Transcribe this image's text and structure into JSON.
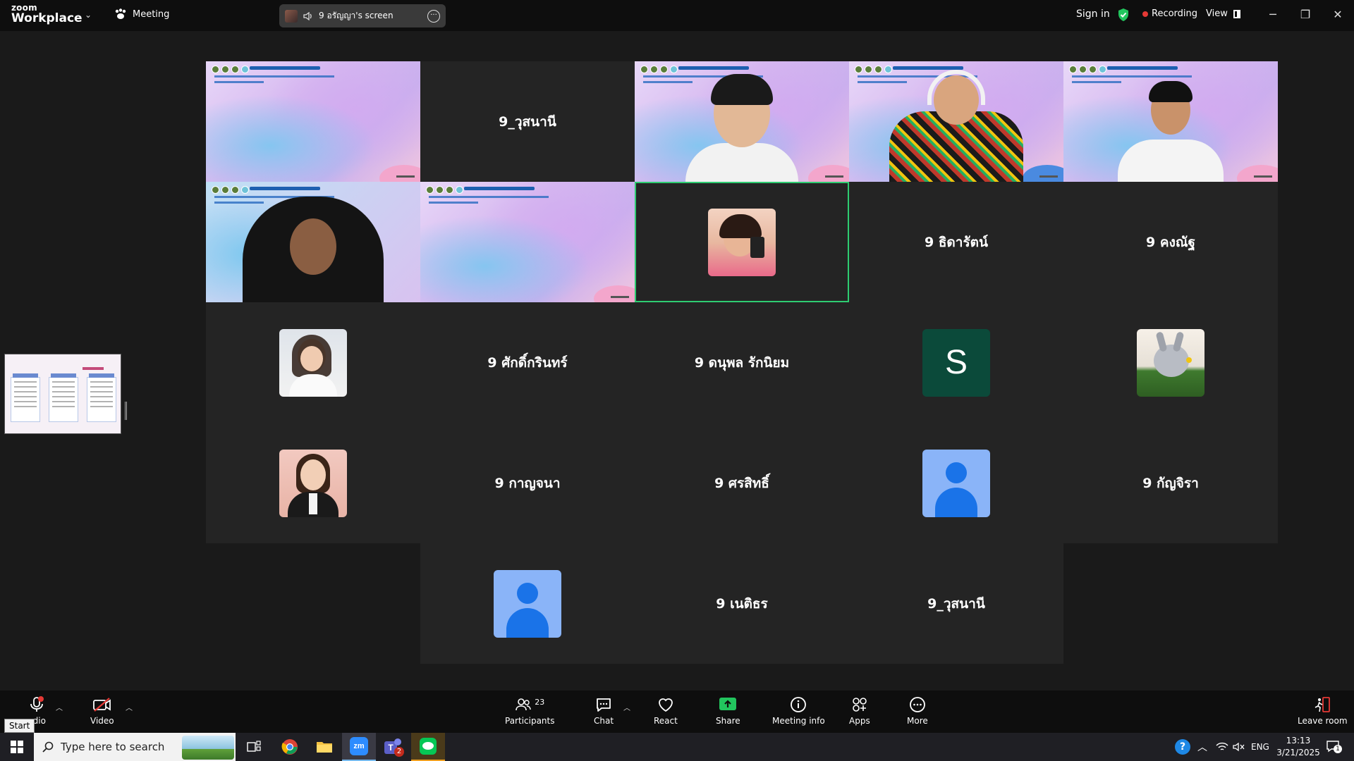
{
  "titlebar": {
    "logo_top": "zoom",
    "logo_bottom": "Workplace",
    "meeting_label": "Meeting",
    "share_label": "9 อรัญญา's screen",
    "sign_in": "Sign in",
    "recording": "Recording",
    "view": "View"
  },
  "tiles": [
    {
      "name": "",
      "kind": "slide"
    },
    {
      "name": "9_วุสนานี",
      "kind": "name"
    },
    {
      "name": "",
      "kind": "video"
    },
    {
      "name": "",
      "kind": "video"
    },
    {
      "name": "",
      "kind": "video"
    },
    {
      "name": "",
      "kind": "video"
    },
    {
      "name": "",
      "kind": "slide"
    },
    {
      "name": "",
      "kind": "photo"
    },
    {
      "name": "9 ธิดารัตน์",
      "kind": "name"
    },
    {
      "name": "9 คงณัฐ",
      "kind": "name"
    },
    {
      "name": "",
      "kind": "photo"
    },
    {
      "name": "9 ศักดิ์กรินทร์",
      "kind": "name"
    },
    {
      "name": "9 ดนุพล รักนิยม",
      "kind": "name"
    },
    {
      "name": "S",
      "kind": "letter"
    },
    {
      "name": "",
      "kind": "photo"
    },
    {
      "name": "",
      "kind": "photo"
    },
    {
      "name": "9 กาญจนา",
      "kind": "name"
    },
    {
      "name": "9 ศรสิทธิ์",
      "kind": "name"
    },
    {
      "name": "",
      "kind": "avatar"
    },
    {
      "name": "9 กัญจิรา",
      "kind": "name"
    },
    {
      "name": "",
      "kind": "avatar"
    },
    {
      "name": "9 เนติธร",
      "kind": "name"
    },
    {
      "name": "9_วุสนานี",
      "kind": "name"
    }
  ],
  "toolbar": {
    "audio": "udio",
    "video": "Video",
    "participants": "Participants",
    "participants_count": "23",
    "chat": "Chat",
    "react": "React",
    "share": "Share",
    "meeting_info": "Meeting info",
    "apps": "Apps",
    "more": "More",
    "leave": "Leave room",
    "start_tip": "Start"
  },
  "taskbar": {
    "search_placeholder": "Type here to search",
    "teams_badge": "2",
    "language": "ENG",
    "time": "13:13",
    "date": "3/21/2025",
    "notif_count": "1"
  },
  "colors": {
    "active_speaker": "#2ecc71",
    "share_green": "#22c55e",
    "record_red": "#e53935",
    "avatar_blue": "#8ab4f8"
  }
}
